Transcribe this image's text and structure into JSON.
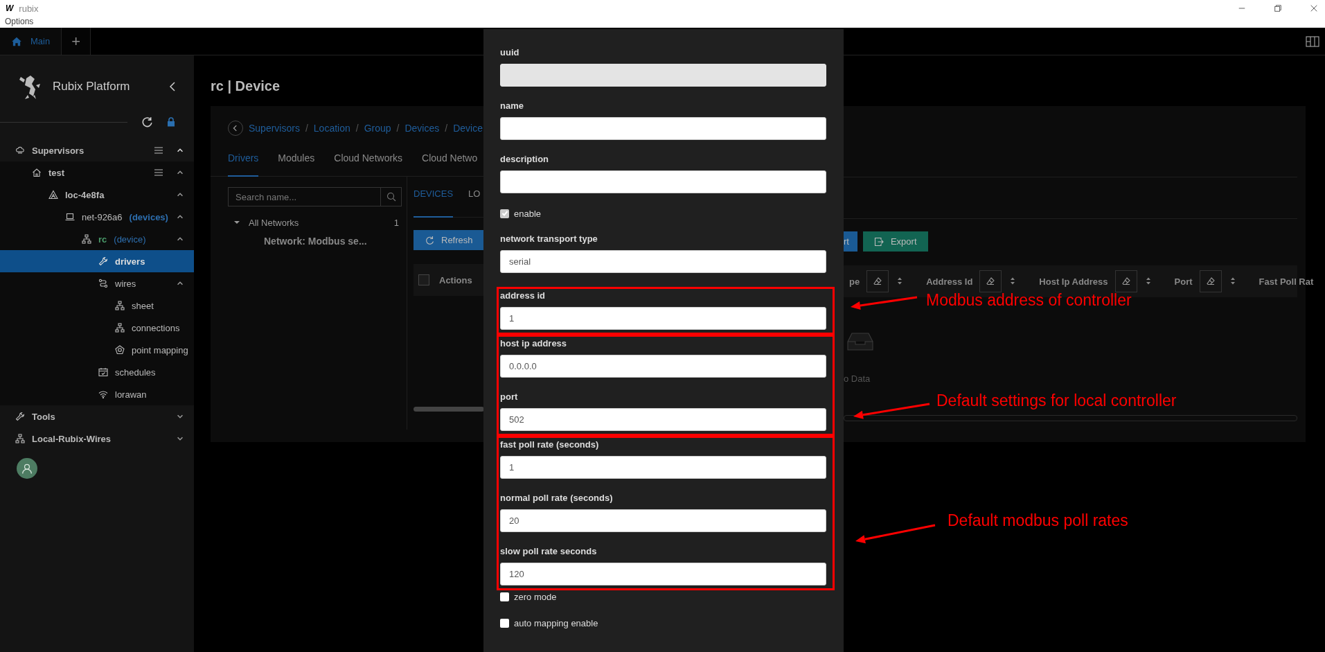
{
  "titlebar": {
    "logo": "W",
    "title": "rubix"
  },
  "menu": [
    "Options"
  ],
  "tabs": [
    {
      "label": "Main",
      "selected": true
    }
  ],
  "new_tab_button": {
    "label": "+"
  },
  "sidebar": {
    "title": "Rubix Platform",
    "items": [
      {
        "label": "Supervisors",
        "menu": true,
        "expanded": true,
        "selected": false,
        "children": [
          {
            "label": "test",
            "menu": true,
            "expanded": true,
            "selected": false,
            "children": [
              {
                "label": "loc-4e8fa",
                "expanded": true,
                "selected": false,
                "children": [
                  {
                    "label": "net-926a6",
                    "suffix": "(devices)",
                    "expanded": true,
                    "selected": false,
                    "children": [
                      {
                        "label": "rc",
                        "suffix": "(device)",
                        "color": "#4a9a6a",
                        "expanded": true,
                        "selected": false,
                        "children": [
                          {
                            "label": "drivers",
                            "selected": true
                          },
                          {
                            "label": "wires",
                            "expanded": true,
                            "selected": false,
                            "children": [
                              {
                                "label": "sheet",
                                "selected": false
                              },
                              {
                                "label": "connections",
                                "selected": false
                              },
                              {
                                "label": "point mapping",
                                "selected": false
                              }
                            ]
                          },
                          {
                            "label": "schedules",
                            "selected": false
                          },
                          {
                            "label": "lorawan",
                            "selected": false
                          }
                        ]
                      }
                    ]
                  }
                ]
              }
            ]
          }
        ]
      },
      {
        "label": "Tools",
        "expanded": false,
        "selected": false
      },
      {
        "label": "Local-Rubix-Wires",
        "expanded": false,
        "selected": false
      }
    ]
  },
  "page": {
    "heading": "rc | Device",
    "breadcrumb": [
      {
        "kind": "link",
        "label": "Supervisors"
      },
      {
        "kind": "separator",
        "label": "/"
      },
      {
        "kind": "link",
        "label": "Location"
      },
      {
        "kind": "separator",
        "label": "/"
      },
      {
        "kind": "link",
        "label": "Group"
      },
      {
        "kind": "separator",
        "label": "/"
      },
      {
        "kind": "link",
        "label": "Devices"
      },
      {
        "kind": "separator",
        "label": "/"
      },
      {
        "kind": "link",
        "label": "Device"
      }
    ],
    "tabs": [
      {
        "label": "Drivers",
        "selected": true
      },
      {
        "label": "Modules",
        "selected": false
      },
      {
        "label": "Cloud Networks",
        "selected": false
      },
      {
        "label": "Cloud Netwo",
        "selected": false
      }
    ],
    "search": {
      "placeholder": "Search name..."
    },
    "networks": {
      "label": "All Networks",
      "count": "1",
      "expanded": true,
      "children": [
        {
          "label": "Network: Modbus se..."
        }
      ]
    },
    "subtabs": [
      {
        "label": "DEVICES",
        "selected": true
      },
      {
        "label": "LO",
        "selected": false
      }
    ],
    "buttons": [
      {
        "kind": "refresh",
        "label": "Refresh"
      },
      {
        "kind": "import",
        "label": "rt"
      },
      {
        "kind": "export",
        "label": "Export"
      }
    ],
    "table": {
      "select_all": {
        "checked": false
      },
      "columns": [
        {
          "label": "Actions",
          "filter": false
        },
        {
          "label": "pe",
          "filter": true
        },
        {
          "label": "Address Id",
          "filter": true
        },
        {
          "label": "Host Ip Address",
          "filter": true
        },
        {
          "label": "Port",
          "filter": true
        },
        {
          "label": "Fast Poll Rat",
          "filter": false
        }
      ]
    },
    "empty_text": "o Data"
  },
  "dialog": {
    "sections": [
      {
        "highlighted": false,
        "fields": [
          {
            "kind": "text",
            "label": "uuid",
            "disabled": true
          },
          {
            "kind": "text",
            "label": "name",
            "disabled": false
          },
          {
            "kind": "text",
            "label": "description",
            "disabled": false
          },
          {
            "kind": "checkbox",
            "label": "enable",
            "checked": true
          },
          {
            "kind": "text",
            "label": "network transport type",
            "value": "serial",
            "disabled": false
          }
        ]
      },
      {
        "highlighted": true,
        "fields": [
          {
            "kind": "text",
            "label": "address id",
            "value": "1",
            "disabled": false
          }
        ]
      },
      {
        "highlighted": true,
        "fields": [
          {
            "kind": "text",
            "label": "host ip address",
            "value": "0.0.0.0",
            "disabled": false
          },
          {
            "kind": "text",
            "label": "port",
            "value": "502",
            "disabled": false
          }
        ]
      },
      {
        "highlighted": true,
        "fields": [
          {
            "kind": "text",
            "label": "fast poll rate (seconds)",
            "value": "1",
            "disabled": false
          },
          {
            "kind": "text",
            "label": "normal poll rate (seconds)",
            "value": "20",
            "disabled": false
          },
          {
            "kind": "text",
            "label": "slow poll rate seconds",
            "value": "120",
            "disabled": false
          }
        ]
      },
      {
        "highlighted": false,
        "fields": [
          {
            "kind": "checkbox",
            "label": "zero mode",
            "checked": false
          },
          {
            "kind": "checkbox",
            "label": "auto mapping enable",
            "checked": false
          }
        ]
      }
    ]
  },
  "annotations": [
    {
      "text": "Modbus address of controller"
    },
    {
      "text": "Default settings for local controller"
    },
    {
      "text": "Default modbus poll rates"
    }
  ]
}
